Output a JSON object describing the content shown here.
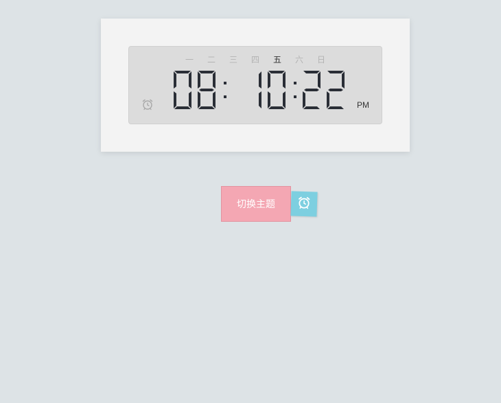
{
  "clock": {
    "weekdays": [
      "一",
      "二",
      "三",
      "四",
      "五",
      "六",
      "日"
    ],
    "active_weekday_index": 4,
    "hours": "08",
    "minutes": "10",
    "seconds": "22",
    "ampm": "PM"
  },
  "controls": {
    "theme_button_label": "切换主题"
  },
  "icons": {
    "display_alarm": "alarm-clock-icon",
    "tab_alarm": "alarm-clock-icon"
  },
  "colors": {
    "background": "#dde3e6",
    "card": "#f3f3f3",
    "display": "#dcdcdc",
    "digit": "#2a2e36",
    "theme_button": "#f4a7b3",
    "alarm_tab": "#7dcfe0"
  }
}
